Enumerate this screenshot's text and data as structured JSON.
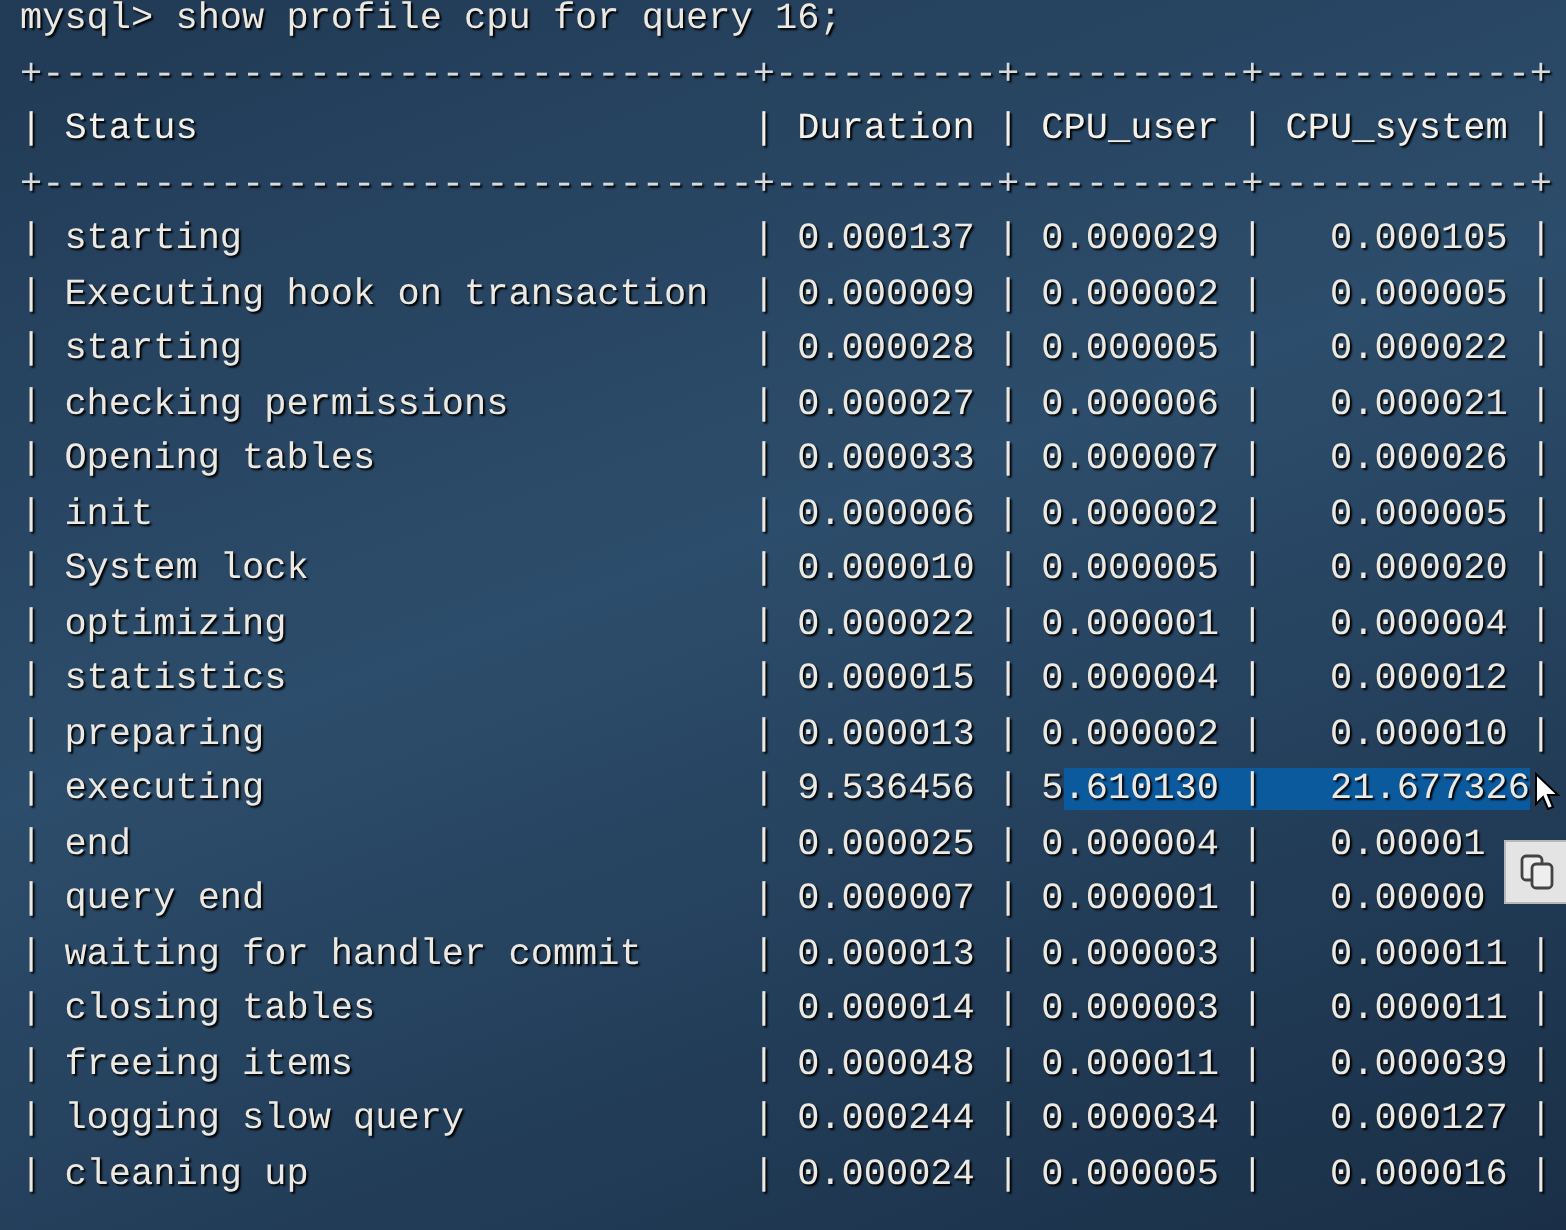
{
  "prompt": "mysql> show profile cpu for query 16;",
  "lines": [
    {
      "kind": "border",
      "text": "+--------------------------------+----------+----------+------------+"
    },
    {
      "kind": "header",
      "text": "| Status                         | Duration | CPU_user | CPU_system |"
    },
    {
      "kind": "border",
      "text": "+--------------------------------+----------+----------+------------+"
    },
    {
      "kind": "row",
      "text": "| starting                       | 0.000137 | 0.000029 |   0.000105 |"
    },
    {
      "kind": "row",
      "text": "| Executing hook on transaction  | 0.000009 | 0.000002 |   0.000005 |"
    },
    {
      "kind": "row",
      "text": "| starting                       | 0.000028 | 0.000005 |   0.000022 |"
    },
    {
      "kind": "row",
      "text": "| checking permissions           | 0.000027 | 0.000006 |   0.000021 |"
    },
    {
      "kind": "row",
      "text": "| Opening tables                 | 0.000033 | 0.000007 |   0.000026 |"
    },
    {
      "kind": "row",
      "text": "| init                           | 0.000006 | 0.000002 |   0.000005 |"
    },
    {
      "kind": "row",
      "text": "| System lock                    | 0.000010 | 0.000005 |   0.000020 |"
    },
    {
      "kind": "row",
      "text": "| optimizing                     | 0.000022 | 0.000001 |   0.000004 |"
    },
    {
      "kind": "row",
      "text": "| statistics                     | 0.000015 | 0.000004 |   0.000012 |"
    },
    {
      "kind": "row",
      "text": "| preparing                      | 0.000013 | 0.000002 |   0.000010 |"
    },
    {
      "kind": "row",
      "text": "| executing                      | 9.536456 | 5",
      "selection": ".610130 |   21.677326"
    },
    {
      "kind": "row",
      "text": "| end                            | 0.000025 | 0.000004 |   0.00001"
    },
    {
      "kind": "row",
      "text": "| query end                      | 0.000007 | 0.000001 |   0.00000"
    },
    {
      "kind": "row",
      "text": "| waiting for handler commit     | 0.000013 | 0.000003 |   0.000011 |"
    },
    {
      "kind": "row",
      "text": "| closing tables                 | 0.000014 | 0.000003 |   0.000011 |"
    },
    {
      "kind": "row",
      "text": "| freeing items                  | 0.000048 | 0.000011 |   0.000039 |"
    },
    {
      "kind": "row",
      "text": "| logging slow query             | 0.000244 | 0.000034 |   0.000127 |"
    },
    {
      "kind": "row",
      "text": "| cleaning up                    | 0.000024 | 0.000005 |   0.000016 |"
    }
  ]
}
